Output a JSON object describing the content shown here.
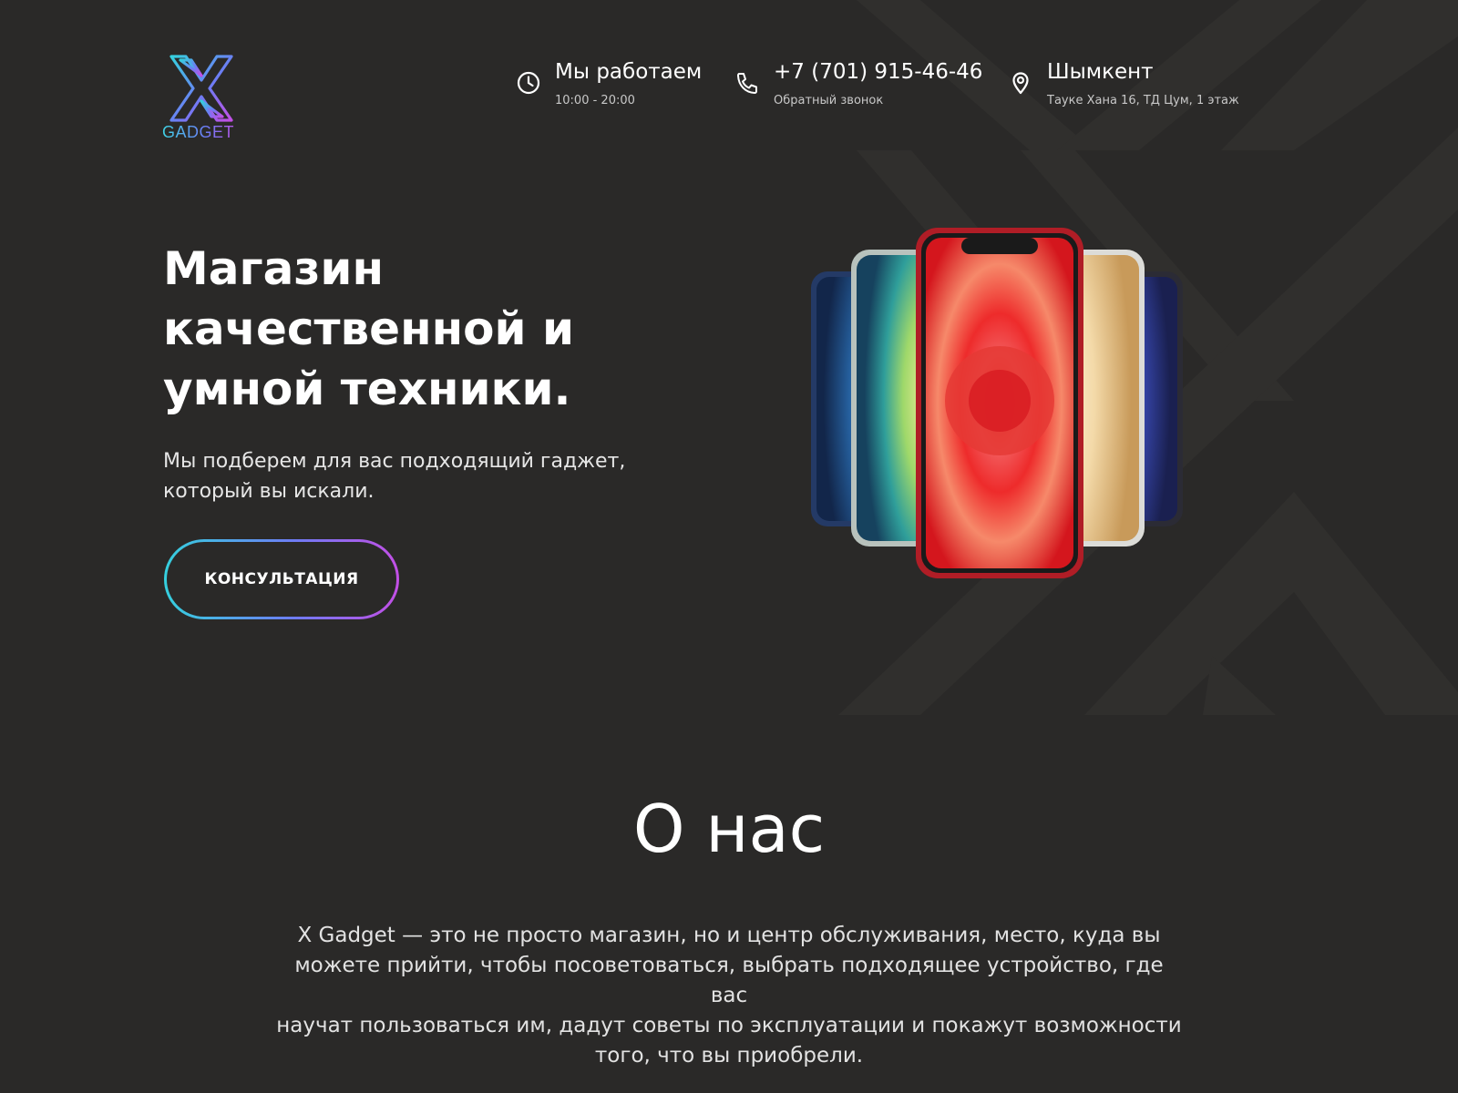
{
  "logo": {
    "word": "GADGET",
    "icon": "x-logo-icon"
  },
  "header": {
    "hours": {
      "title": "Мы работаем",
      "subtitle": "10:00 - 20:00",
      "icon": "clock-icon"
    },
    "phone": {
      "title": "+7 (701) 915-46-46",
      "subtitle": "Обратный звонок",
      "icon": "phone-icon"
    },
    "location": {
      "title": "Шымкент",
      "subtitle": "Тауке Хана 16, ТД Цум, 1 этаж",
      "icon": "map-pin-icon"
    }
  },
  "hero": {
    "title_line1": "Магазин",
    "title_line2": "качественной и",
    "title_line3": "умной техники.",
    "subtitle_line1": "Мы подберем для вас подходящий гаджет,",
    "subtitle_line2": "который вы искали.",
    "cta_label": "КОНСУЛЬТАЦИЯ"
  },
  "about": {
    "title": "О нас",
    "text_line1": "X Gadget — это не просто магазин, но и центр обслуживания, место, куда вы",
    "text_line2": "можете прийти, чтобы посоветоваться, выбрать подходящее устройство, где вас",
    "text_line3": "научат пользоваться им, дадут советы по эксплуатации и покажут возможности",
    "text_line4": "того, что вы приобрели."
  },
  "colors": {
    "background": "#2a2928",
    "gradient_start": "#35d0de",
    "gradient_mid": "#6d7cf4",
    "gradient_end": "#c34fe6",
    "text": "#ffffff"
  }
}
